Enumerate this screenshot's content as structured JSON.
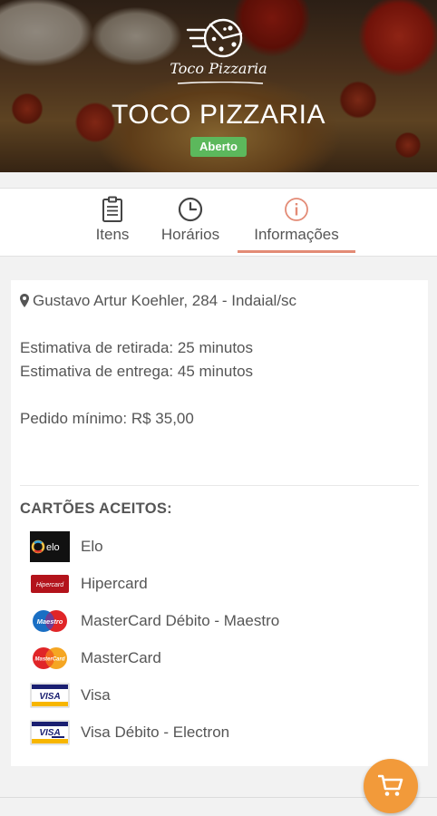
{
  "store": {
    "logo_text": "Toco Pizzaria",
    "name": "TOCO PIZZARIA",
    "status": "Aberto"
  },
  "tabs": [
    {
      "label": "Itens",
      "icon": "clipboard-icon"
    },
    {
      "label": "Horários",
      "icon": "clock-icon"
    },
    {
      "label": "Informações",
      "icon": "info-icon",
      "active": true
    }
  ],
  "info": {
    "address": "Gustavo Artur Koehler, 284 - Indaial/sc",
    "pickup_estimate": "Estimativa de retirada: 25 minutos",
    "delivery_estimate": "Estimativa de entrega: 45 minutos",
    "minimum_order": "Pedido mínimo: R$ 35,00"
  },
  "accepted_cards": {
    "heading": "CARTÕES ACEITOS:",
    "items": [
      {
        "label": "Elo",
        "icon": "elo-logo"
      },
      {
        "label": "Hipercard",
        "icon": "hipercard-logo"
      },
      {
        "label": "MasterCard Débito - Maestro",
        "icon": "maestro-logo"
      },
      {
        "label": "MasterCard",
        "icon": "mastercard-logo"
      },
      {
        "label": "Visa",
        "icon": "visa-logo"
      },
      {
        "label": "Visa Débito - Electron",
        "icon": "visa-electron-logo"
      }
    ]
  },
  "colors": {
    "accent": "#e38b76",
    "open_badge": "#5cb85c",
    "cart_button": "#f29a3a"
  }
}
